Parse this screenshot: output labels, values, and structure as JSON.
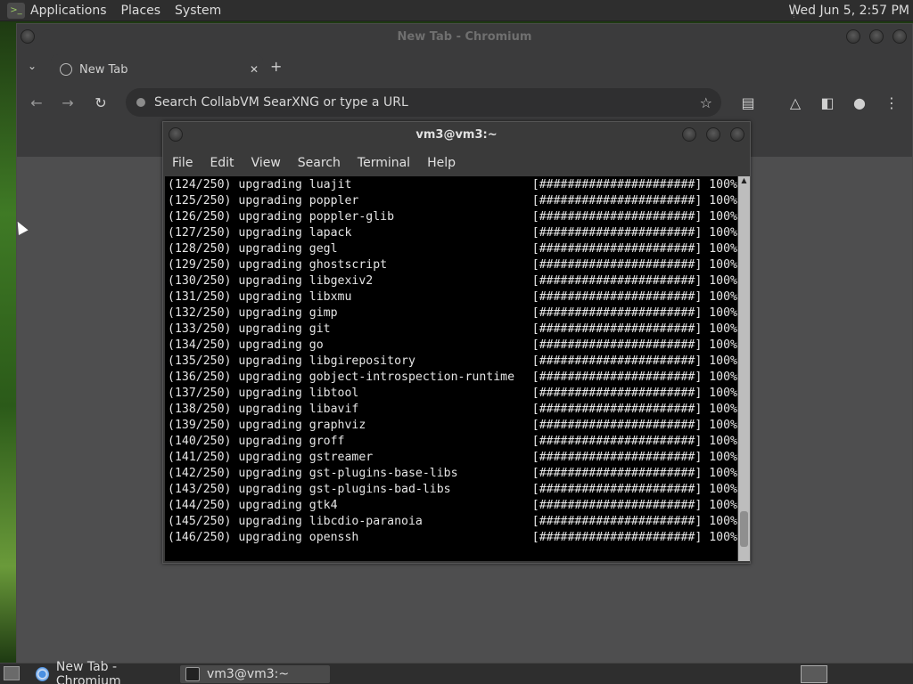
{
  "top_panel": {
    "menus": [
      "Applications",
      "Places",
      "System"
    ],
    "clock": "Wed Jun  5,  2:57 PM"
  },
  "chromium": {
    "window_title": "New Tab - Chromium",
    "tab_title": "New Tab",
    "tab_close": "✕",
    "new_tab": "+",
    "omnibox_placeholder": "Search CollabVM SearXNG or type a URL"
  },
  "terminal": {
    "title": "vm3@vm3:~",
    "menus": [
      "File",
      "Edit",
      "View",
      "Search",
      "Terminal",
      "Help"
    ],
    "lines": [
      {
        "left": "(124/250) upgrading luajit",
        "right": "[######################] 100%"
      },
      {
        "left": "(125/250) upgrading poppler",
        "right": "[######################] 100%"
      },
      {
        "left": "(126/250) upgrading poppler-glib",
        "right": "[######################] 100%"
      },
      {
        "left": "(127/250) upgrading lapack",
        "right": "[######################] 100%"
      },
      {
        "left": "(128/250) upgrading gegl",
        "right": "[######################] 100%"
      },
      {
        "left": "(129/250) upgrading ghostscript",
        "right": "[######################] 100%"
      },
      {
        "left": "(130/250) upgrading libgexiv2",
        "right": "[######################] 100%"
      },
      {
        "left": "(131/250) upgrading libxmu",
        "right": "[######################] 100%"
      },
      {
        "left": "(132/250) upgrading gimp",
        "right": "[######################] 100%"
      },
      {
        "left": "(133/250) upgrading git",
        "right": "[######################] 100%"
      },
      {
        "left": "(134/250) upgrading go",
        "right": "[######################] 100%"
      },
      {
        "left": "(135/250) upgrading libgirepository",
        "right": "[######################] 100%"
      },
      {
        "left": "(136/250) upgrading gobject-introspection-runtime",
        "right": "[######################] 100%"
      },
      {
        "left": "(137/250) upgrading libtool",
        "right": "[######################] 100%"
      },
      {
        "left": "(138/250) upgrading libavif",
        "right": "[######################] 100%"
      },
      {
        "left": "(139/250) upgrading graphviz",
        "right": "[######################] 100%"
      },
      {
        "left": "(140/250) upgrading groff",
        "right": "[######################] 100%"
      },
      {
        "left": "(141/250) upgrading gstreamer",
        "right": "[######################] 100%"
      },
      {
        "left": "(142/250) upgrading gst-plugins-base-libs",
        "right": "[######################] 100%"
      },
      {
        "left": "(143/250) upgrading gst-plugins-bad-libs",
        "right": "[######################] 100%"
      },
      {
        "left": "(144/250) upgrading gtk4",
        "right": "[######################] 100%"
      },
      {
        "left": "(145/250) upgrading libcdio-paranoia",
        "right": "[######################] 100%"
      },
      {
        "left": "(146/250) upgrading openssh",
        "right": "[######################] 100%"
      }
    ]
  },
  "taskbar": {
    "tasks": [
      "New Tab - Chromium",
      "vm3@vm3:~"
    ]
  }
}
